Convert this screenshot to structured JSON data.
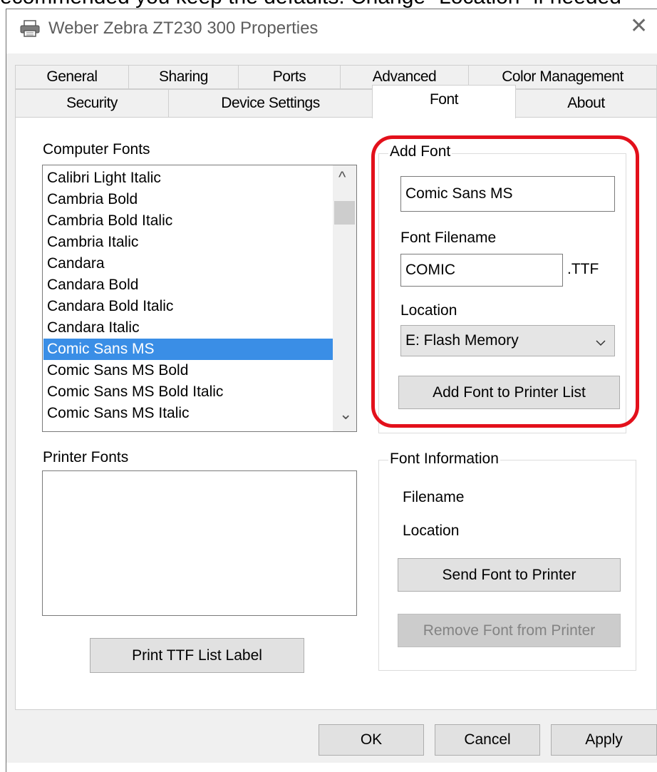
{
  "caption": "ecommended you keep the defaults. Change \"Location\" if needed",
  "window": {
    "title": "Weber Zebra ZT230 300 Properties",
    "close_glyph": "✕"
  },
  "tabs": {
    "row1": [
      "General",
      "Sharing",
      "Ports",
      "Advanced",
      "Color Management"
    ],
    "row2": [
      "Security",
      "Device Settings",
      "Font",
      "About"
    ],
    "active": "Font"
  },
  "computer_fonts": {
    "label": "Computer Fonts",
    "items": [
      "Calibri Light Italic",
      "Cambria Bold",
      "Cambria Bold Italic",
      "Cambria Italic",
      "Candara",
      "Candara Bold",
      "Candara Bold Italic",
      "Candara Italic",
      "Comic Sans MS",
      "Comic Sans MS Bold",
      "Comic Sans MS Bold Italic",
      "Comic Sans MS Italic"
    ],
    "selected": "Comic Sans MS",
    "scroll_up": "^",
    "scroll_down": "⌄"
  },
  "printer_fonts": {
    "label": "Printer Fonts",
    "items": []
  },
  "print_button": "Print TTF List Label",
  "add_font": {
    "legend": "Add Font",
    "font_name_value": "Comic Sans MS",
    "filename_label": "Font Filename",
    "filename_value": "COMIC",
    "extension": ".TTF",
    "location_label": "Location",
    "location_value": "E: Flash Memory",
    "add_button": "Add Font to Printer List"
  },
  "font_information": {
    "legend": "Font Information",
    "filename_label": "Filename",
    "location_label": "Location",
    "send_button": "Send Font to Printer",
    "remove_button": "Remove Font from Printer"
  },
  "footer": {
    "ok": "OK",
    "cancel": "Cancel",
    "apply": "Apply"
  },
  "colors": {
    "selection": "#3a8ee6",
    "highlight_ring": "#e3101b",
    "dialog_bg": "#f0f0f0"
  }
}
